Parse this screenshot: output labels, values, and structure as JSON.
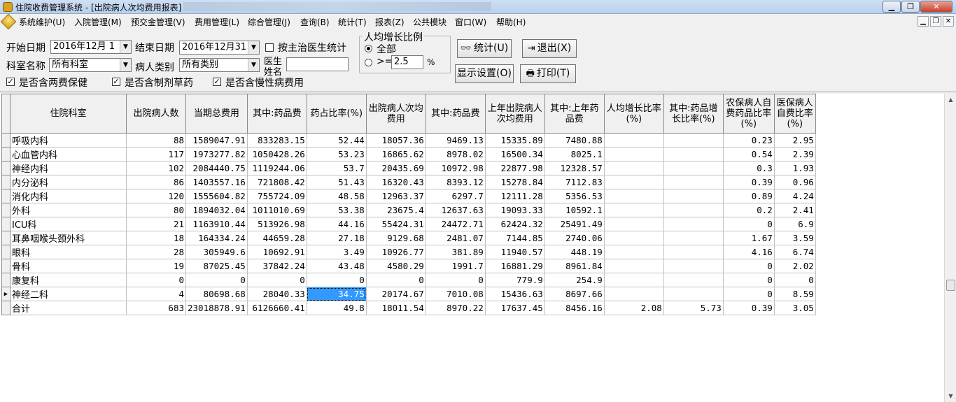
{
  "window": {
    "title": "住院收费管理系统 - [出院病人次均费用报表]",
    "minimize": "▁",
    "restore": "❐",
    "close": "✕"
  },
  "menu": {
    "items": [
      "系统维护(U)",
      "入院管理(M)",
      "预交金管理(V)",
      "费用管理(L)",
      "综合管理(J)",
      "查询(B)",
      "统计(T)",
      "报表(Z)",
      "公共模块",
      "窗口(W)",
      "帮助(H)"
    ],
    "mdi_min": "▁",
    "mdi_restore": "❐",
    "mdi_close": "✕"
  },
  "filters": {
    "start_date_label": "开始日期",
    "start_date": "2016年12月 1",
    "end_date_label": "结束日期",
    "end_date": "2016年12月31",
    "by_doctor_label": "按主治医生统计",
    "dept_label": "科室名称",
    "dept_value": "所有科室",
    "patient_type_label": "病人类别",
    "patient_type_value": "所有类别",
    "doctor_label_1": "医生",
    "doctor_label_2": "姓名",
    "doctor_value": "",
    "include_two_fee": "是否含两费保健",
    "include_herbal": "是否含制剂草药",
    "include_chronic": "是否含慢性病费用",
    "checkbox_mark": "✓",
    "dropdown_arrow": "▼"
  },
  "growth": {
    "title": "人均增长比例",
    "all_label": "全部",
    "gte_label": ">=",
    "gte_value": "2.5",
    "percent": "%"
  },
  "buttons": {
    "stats": "统计(U)",
    "exit": "退出(X)",
    "display": "显示设置(O)",
    "print": "打印(T)"
  },
  "table": {
    "headers": [
      "住院科室",
      "出院病人数",
      "当期总费用",
      "其中:药品费",
      "药占比率(%)",
      "出院病人次均费用",
      "其中:药品费",
      "上年出院病人次均费用",
      "其中:上年药品费",
      "人均增长比率(%)",
      "其中:药品增长比率(%)",
      "农保病人自费药品比率(%)",
      "医保病人自费比率(%)"
    ],
    "rows": [
      [
        "呼吸内科",
        "88",
        "1589047.91",
        "833283.15",
        "52.44",
        "18057.36",
        "9469.13",
        "15335.89",
        "7480.88",
        "",
        "",
        "0.23",
        "2.95"
      ],
      [
        "心血管内科",
        "117",
        "1973277.82",
        "1050428.26",
        "53.23",
        "16865.62",
        "8978.02",
        "16500.34",
        "8025.1",
        "",
        "",
        "0.54",
        "2.39"
      ],
      [
        "神经内科",
        "102",
        "2084440.75",
        "1119244.06",
        "53.7",
        "20435.69",
        "10972.98",
        "22877.98",
        "12328.57",
        "",
        "",
        "0.3",
        "1.93"
      ],
      [
        "内分泌科",
        "86",
        "1403557.16",
        "721808.42",
        "51.43",
        "16320.43",
        "8393.12",
        "15278.84",
        "7112.83",
        "",
        "",
        "0.39",
        "0.96"
      ],
      [
        "消化内科",
        "120",
        "1555604.82",
        "755724.09",
        "48.58",
        "12963.37",
        "6297.7",
        "12111.28",
        "5356.53",
        "",
        "",
        "0.89",
        "4.24"
      ],
      [
        "外科",
        "80",
        "1894032.04",
        "1011010.69",
        "53.38",
        "23675.4",
        "12637.63",
        "19093.33",
        "10592.1",
        "",
        "",
        "0.2",
        "2.41"
      ],
      [
        "ICU科",
        "21",
        "1163910.44",
        "513926.98",
        "44.16",
        "55424.31",
        "24472.71",
        "62424.32",
        "25491.49",
        "",
        "",
        "0",
        "6.9"
      ],
      [
        "耳鼻咽喉头颈外科",
        "18",
        "164334.24",
        "44659.28",
        "27.18",
        "9129.68",
        "2481.07",
        "7144.85",
        "2740.06",
        "",
        "",
        "1.67",
        "3.59"
      ],
      [
        "眼科",
        "28",
        "305949.6",
        "10692.91",
        "3.49",
        "10926.77",
        "381.89",
        "11940.57",
        "448.19",
        "",
        "",
        "4.16",
        "6.74"
      ],
      [
        "骨科",
        "19",
        "87025.45",
        "37842.24",
        "43.48",
        "4580.29",
        "1991.7",
        "16881.29",
        "8961.84",
        "",
        "",
        "0",
        "2.02"
      ],
      [
        "康复科",
        "0",
        "0",
        "0",
        "0",
        "0",
        "0",
        "779.9",
        "254.9",
        "",
        "",
        "0",
        "0"
      ],
      [
        "神经二科",
        "4",
        "80698.68",
        "28040.33",
        "34.75",
        "20174.67",
        "7010.08",
        "15436.63",
        "8697.66",
        "",
        "",
        "0",
        "8.59"
      ],
      [
        "合计",
        "683",
        "23018878.91",
        "6126660.41",
        "49.8",
        "18011.54",
        "8970.22",
        "17637.45",
        "8456.16",
        "2.08",
        "5.73",
        "0.39",
        "3.05"
      ]
    ],
    "current_row_marker": "▶"
  },
  "scrollbar": {
    "up": "▲",
    "down": "▼"
  }
}
